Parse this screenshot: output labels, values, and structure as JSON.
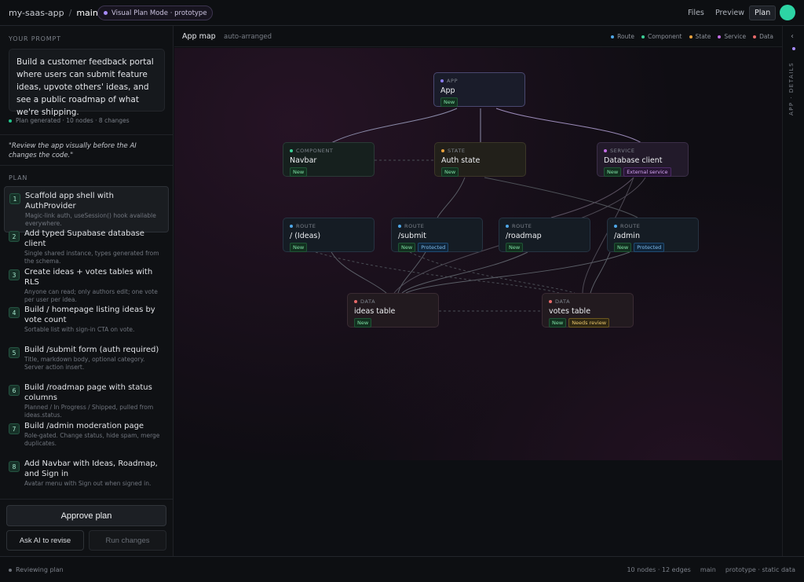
{
  "topbar": {
    "repo": "my-saas-app",
    "separator": "/",
    "branch": "main",
    "mode_pill": "Visual Plan Mode · prototype",
    "files": "Files",
    "preview": "Preview",
    "plan": "Plan"
  },
  "left": {
    "prompt_label": "YOUR PROMPT",
    "prompt_text": "Build a customer feedback portal where users can submit feature ideas, upvote others' ideas, and see a public roadmap of what we're shipping.",
    "generated_line": "Plan generated · 10 nodes · 8 changes",
    "quote": "\"Review the app visually before the AI changes the code.\"",
    "plan_label": "PLAN",
    "steps": [
      {
        "num": "1",
        "title": "Scaffold app shell with AuthProvider",
        "desc": "Magic-link auth, useSession() hook available everywhere."
      },
      {
        "num": "2",
        "title": "Add typed Supabase database client",
        "desc": "Single shared instance, types generated from the schema."
      },
      {
        "num": "3",
        "title": "Create ideas + votes tables with RLS",
        "desc": "Anyone can read; only authors edit; one vote per user per idea."
      },
      {
        "num": "4",
        "title": "Build / homepage listing ideas by vote count",
        "desc": "Sortable list with sign-in CTA on vote."
      },
      {
        "num": "5",
        "title": "Build /submit form (auth required)",
        "desc": "Title, markdown body, optional category. Server action insert."
      },
      {
        "num": "6",
        "title": "Build /roadmap page with status columns",
        "desc": "Planned / In Progress / Shipped, pulled from ideas.status."
      },
      {
        "num": "7",
        "title": "Build /admin moderation page",
        "desc": "Role-gated. Change status, hide spam, merge duplicates."
      },
      {
        "num": "8",
        "title": "Add Navbar with Ideas, Roadmap, and Sign in",
        "desc": "Avatar menu with Sign out when signed in."
      }
    ],
    "approve": "Approve plan",
    "revise": "Ask AI to revise",
    "run": "Run changes"
  },
  "canvas": {
    "title": "App map",
    "subtitle": "auto-arranged",
    "legend": [
      {
        "label": "Route",
        "color": "#4fa8e8"
      },
      {
        "label": "Component",
        "color": "#3ccf96"
      },
      {
        "label": "State",
        "color": "#e8a13c"
      },
      {
        "label": "Service",
        "color": "#c46ee6"
      },
      {
        "label": "Data",
        "color": "#e86a6a"
      }
    ],
    "nodes": {
      "app": {
        "kind": "APP",
        "name": "App",
        "tags": [
          "New"
        ]
      },
      "navbar": {
        "kind": "COMPONENT",
        "name": "Navbar",
        "tags": [
          "New"
        ]
      },
      "auth": {
        "kind": "STATE",
        "name": "Auth state",
        "tags": [
          "New"
        ]
      },
      "db": {
        "kind": "SERVICE",
        "name": "Database client",
        "tags": [
          "New",
          "External service"
        ]
      },
      "ideas_route": {
        "kind": "ROUTE",
        "name": "/ (Ideas)",
        "tags": [
          "New"
        ]
      },
      "submit": {
        "kind": "ROUTE",
        "name": "/submit",
        "tags": [
          "New",
          "Protected"
        ]
      },
      "roadmap": {
        "kind": "ROUTE",
        "name": "/roadmap",
        "tags": [
          "New"
        ]
      },
      "admin": {
        "kind": "ROUTE",
        "name": "/admin",
        "tags": [
          "New",
          "Protected"
        ]
      },
      "ideas_table": {
        "kind": "DATA",
        "name": "ideas table",
        "tags": [
          "New"
        ]
      },
      "votes_table": {
        "kind": "DATA",
        "name": "votes table",
        "tags": [
          "New",
          "Needs review"
        ]
      }
    },
    "colors": {
      "app": "#8b7cf0",
      "component": "#3ccf96",
      "state": "#e8a13c",
      "service": "#c46ee6",
      "route": "#4fa8e8",
      "data": "#e86a6a"
    }
  },
  "rail": {
    "chevron": "‹",
    "label": "APP · DETAILS"
  },
  "status": {
    "left": "Reviewing plan",
    "counts": "10 nodes · 12 edges",
    "branch": "main",
    "mode": "prototype · static data"
  }
}
